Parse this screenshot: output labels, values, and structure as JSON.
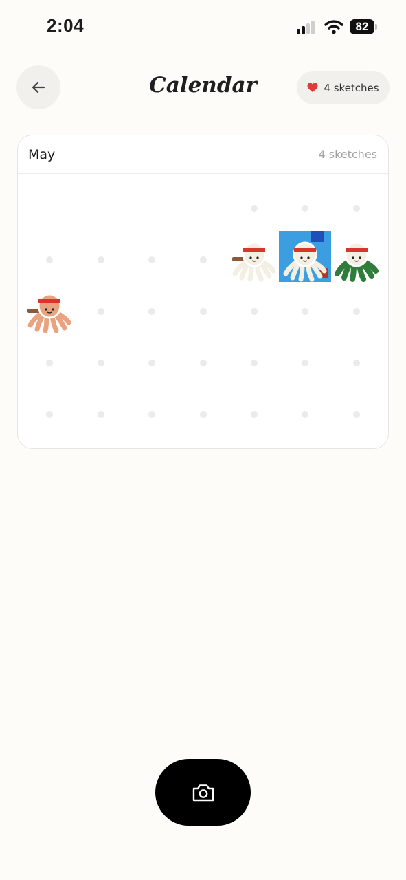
{
  "status_bar": {
    "time": "2:04",
    "battery": "82"
  },
  "header": {
    "title": "Calendar",
    "sketch_count_label": "4 sketches",
    "heart_color": "#e03a3a"
  },
  "calendar": {
    "month": "May",
    "count_label": "4 sketches",
    "days_with_sketches": 4,
    "sticker_icons": [
      "octopus-sketch-icon",
      "octopus-sketch-icon",
      "octopus-sketch-icon",
      "octopus-sketch-icon"
    ]
  },
  "actions": {
    "camera_icon": "camera-icon"
  }
}
